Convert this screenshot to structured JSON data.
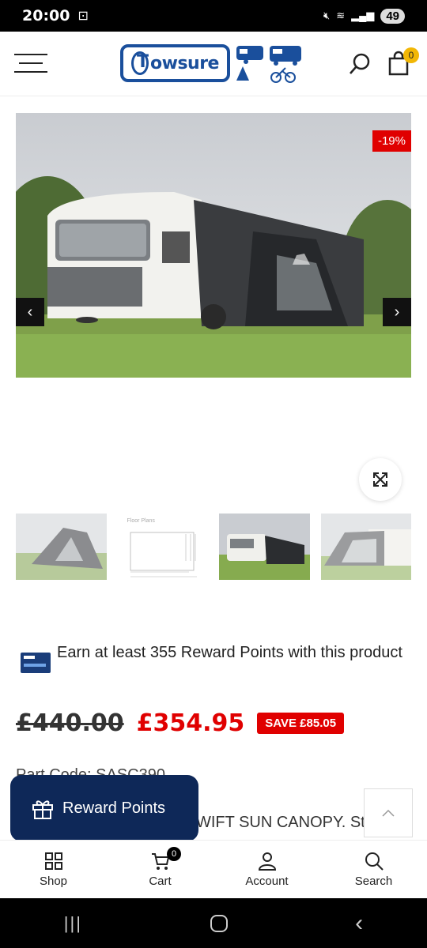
{
  "status_bar": {
    "time": "20:00",
    "battery": "49"
  },
  "header": {
    "logo_text": "owsure",
    "cart_count": "0"
  },
  "product": {
    "discount_badge": "-19%",
    "thumb_label": "Floor Plans",
    "reward_text": "Earn at least 355 Reward Points with this product",
    "old_price": "£440.00",
    "new_price": "£354.95",
    "save_label": "SAVE £85.05",
    "part_code": "Part Code: SASC390",
    "desc_snippet": "WIFT SUN CANOPY. Sty"
  },
  "reward_button": {
    "label": "Reward Points"
  },
  "bottom_nav": {
    "items": [
      {
        "label": "Shop",
        "icon": "grid-icon"
      },
      {
        "label": "Cart",
        "icon": "cart-icon",
        "badge": "0"
      },
      {
        "label": "Account",
        "icon": "user-icon"
      },
      {
        "label": "Search",
        "icon": "search-icon"
      }
    ]
  },
  "colors": {
    "brand_blue": "#1a4f9c",
    "sale_red": "#e00000",
    "reward_navy": "#0e2858",
    "badge_yellow": "#f2b705"
  }
}
